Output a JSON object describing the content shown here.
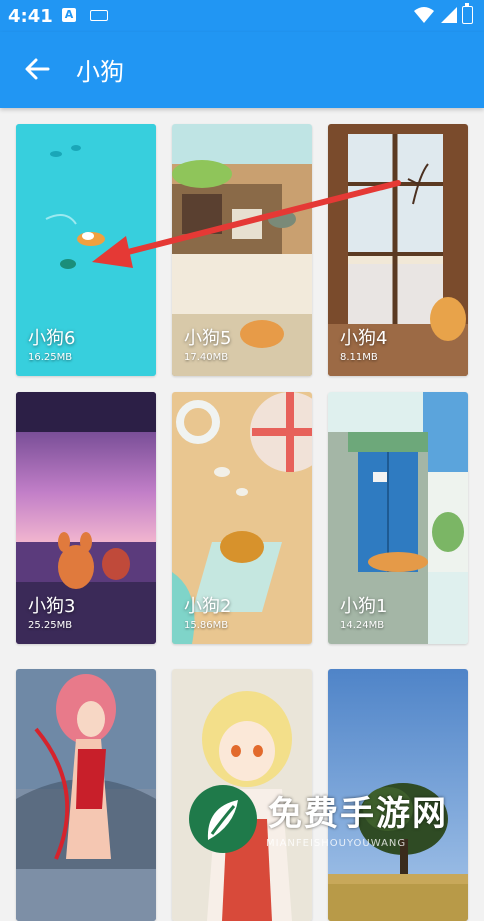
{
  "status_bar": {
    "time": "4:41",
    "a_badge": "A"
  },
  "app_bar": {
    "title": "小狗",
    "back_icon": "arrow-left-icon"
  },
  "colors": {
    "primary": "#2196f3",
    "annotation_arrow": "#e53935"
  },
  "wallpapers": [
    {
      "name": "小狗6",
      "size": "16.25MB"
    },
    {
      "name": "小狗5",
      "size": "17.40MB"
    },
    {
      "name": "小狗4",
      "size": "8.11MB"
    },
    {
      "name": "小狗3",
      "size": "25.25MB"
    },
    {
      "name": "小狗2",
      "size": "15.86MB"
    },
    {
      "name": "小狗1",
      "size": "14.24MB"
    },
    {
      "name": "",
      "size": ""
    },
    {
      "name": "",
      "size": ""
    },
    {
      "name": "",
      "size": ""
    }
  ],
  "watermark": {
    "text": "免费手游网",
    "subtext": "MIANFEISHOUYOUWANG"
  }
}
